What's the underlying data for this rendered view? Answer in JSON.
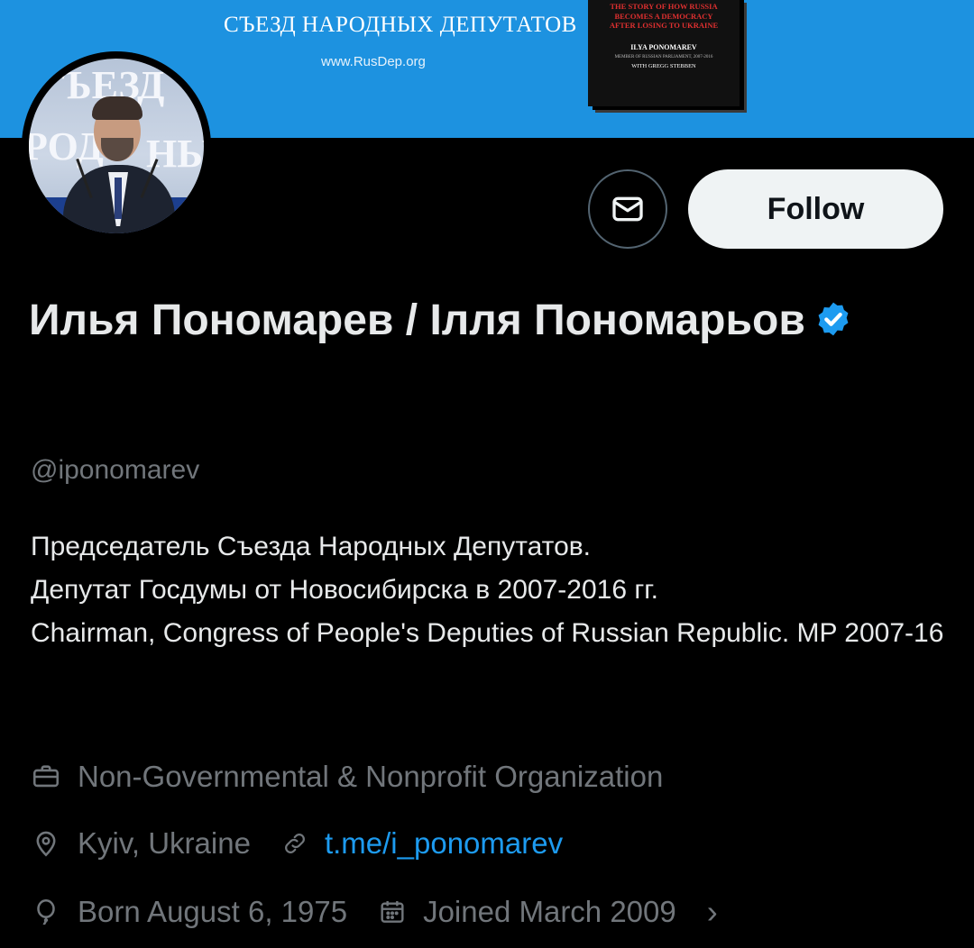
{
  "banner": {
    "title": "СЪЕЗД НАРОДНЫХ ДЕПУТАТОВ",
    "url": "www.RusDep.org",
    "book": {
      "line1": "THE STORY OF HOW RUSSIA",
      "line2": "BECOMES A DEMOCRACY",
      "line3": "AFTER LOSING TO UKRAINE",
      "author": "ILYA PONOMAREV",
      "subtitle": "MEMBER OF RUSSIAN PARLIAMENT, 2007-2016",
      "coauthor": "WITH GREGG STEBBEN"
    }
  },
  "avatar": {
    "text1": "ЪЕЗД",
    "text2": "РОД",
    "text3": "НЫ"
  },
  "actions": {
    "follow_label": "Follow"
  },
  "profile": {
    "name": "Илья Пономарев / Ілля Пономарьов",
    "handle": "@iponomarev",
    "bio": "Председатель Съезда Народных Депутатов.\nДепутат Госдумы от Новосибирска в 2007-2016 гг.\nChairman, Congress of People's Deputies of Russian Republic. MP 2007-16",
    "category": "Non-Governmental & Nonprofit Organization",
    "location": "Kyiv, Ukraine",
    "link": "t.me/i_ponomarev",
    "born": "Born August 6, 1975",
    "joined": "Joined March 2009",
    "chevron": "›"
  },
  "colors": {
    "background": "#000000",
    "banner": "#1d92e0",
    "verified": "#1d9bf0",
    "link": "#1d9bf0",
    "secondary_text": "#71767b",
    "follow_button": "#eff3f4"
  },
  "icons": {
    "message": "envelope-icon",
    "verified": "verified-badge-icon",
    "category": "briefcase-icon",
    "location": "location-pin-icon",
    "link": "link-icon",
    "born": "balloon-icon",
    "joined": "calendar-icon",
    "more": "chevron-right-icon"
  }
}
